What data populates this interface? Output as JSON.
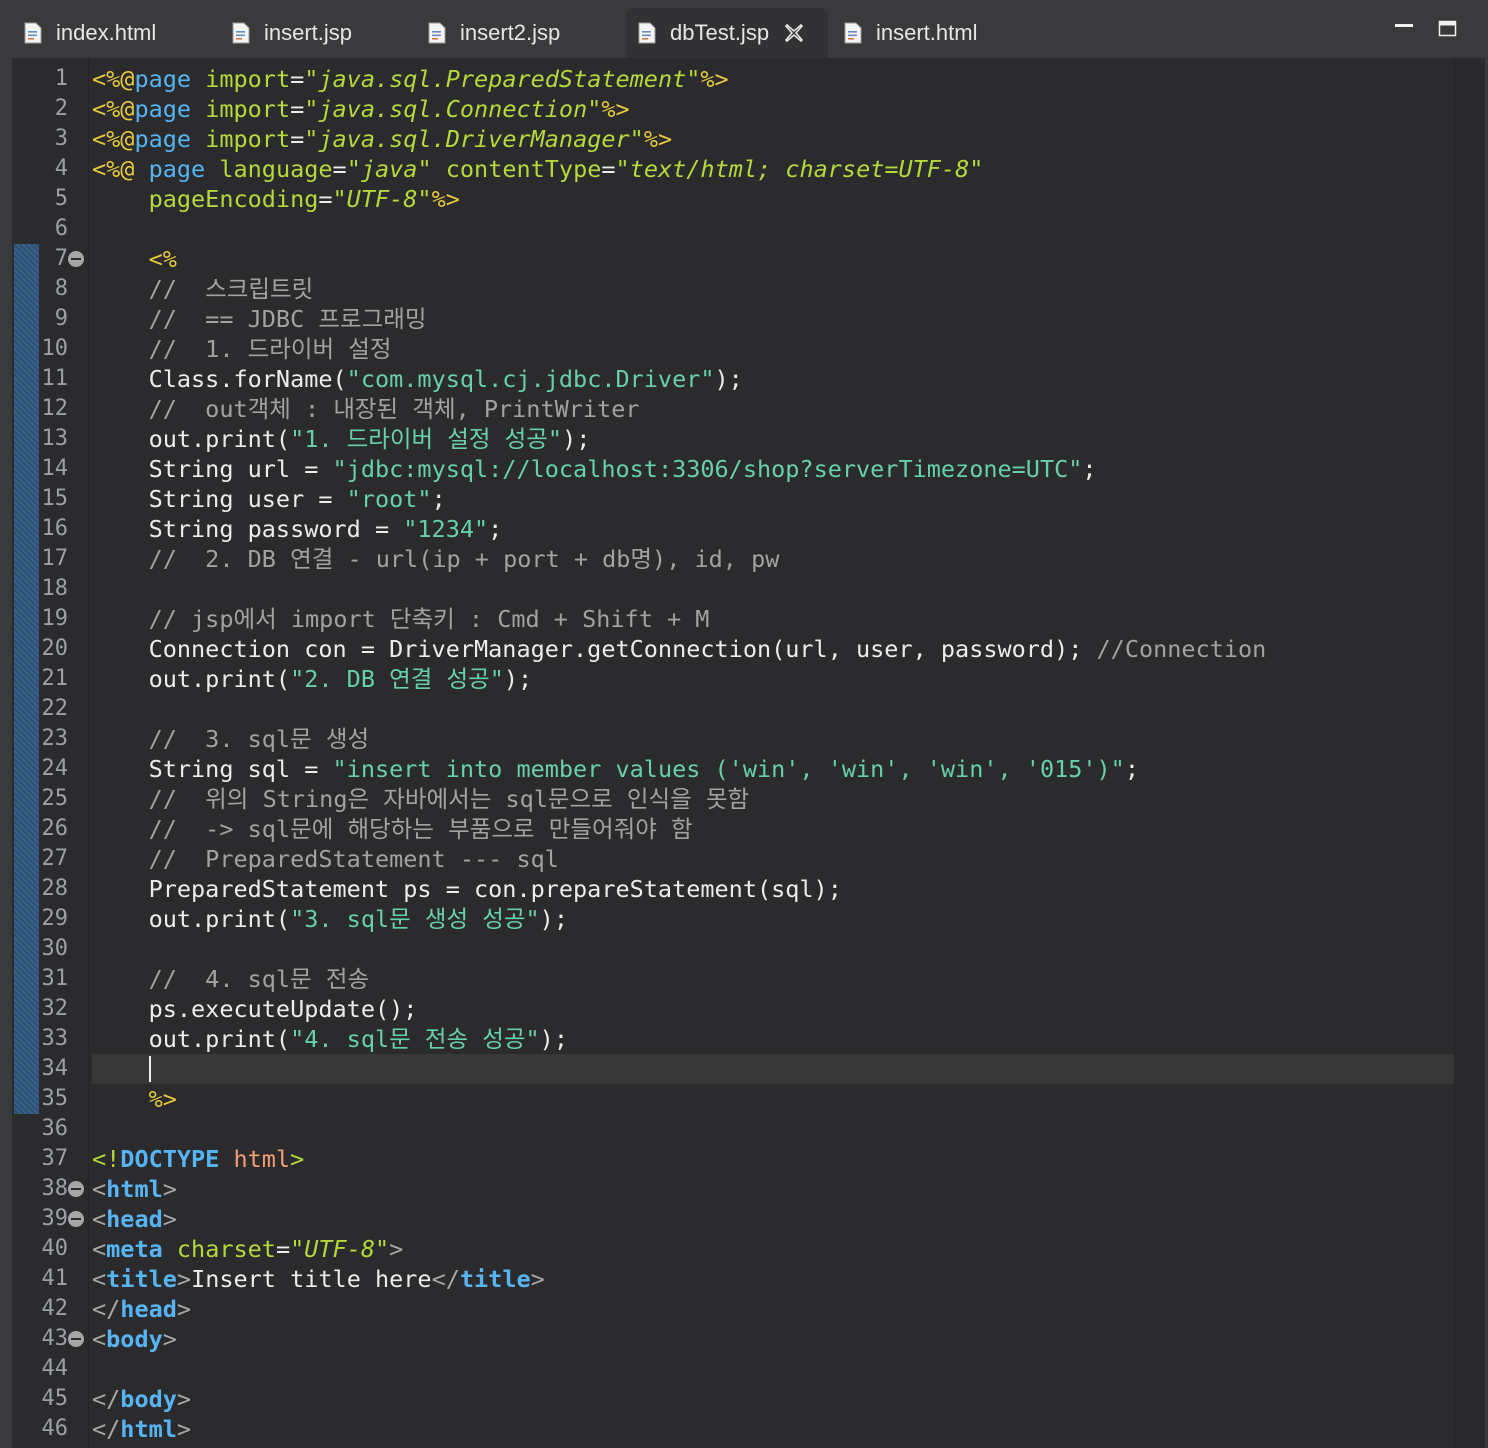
{
  "tabs": [
    {
      "label": "index.html",
      "active": false
    },
    {
      "label": "insert.jsp",
      "active": false
    },
    {
      "label": "insert2.jsp",
      "active": false
    },
    {
      "label": "dbTest.jsp",
      "active": true
    },
    {
      "label": "insert.html",
      "active": false
    }
  ],
  "editor": {
    "current_line": 34,
    "fold_lines": [
      7,
      38,
      39,
      43
    ],
    "lines": [
      [
        [
          "tag",
          "<%@"
        ],
        [
          "dir",
          "page"
        ],
        [
          "plain",
          " "
        ],
        [
          "attr",
          "import"
        ],
        [
          "plain",
          "="
        ],
        [
          "val",
          "\"java.sql.PreparedStatement\""
        ],
        [
          "tag",
          "%>"
        ]
      ],
      [
        [
          "tag",
          "<%@"
        ],
        [
          "dir",
          "page"
        ],
        [
          "plain",
          " "
        ],
        [
          "attr",
          "import"
        ],
        [
          "plain",
          "="
        ],
        [
          "val",
          "\"java.sql.Connection\""
        ],
        [
          "tag",
          "%>"
        ]
      ],
      [
        [
          "tag",
          "<%@"
        ],
        [
          "dir",
          "page"
        ],
        [
          "plain",
          " "
        ],
        [
          "attr",
          "import"
        ],
        [
          "plain",
          "="
        ],
        [
          "val",
          "\"java.sql.DriverManager\""
        ],
        [
          "tag",
          "%>"
        ]
      ],
      [
        [
          "tag",
          "<%@"
        ],
        [
          "plain",
          " "
        ],
        [
          "dir",
          "page"
        ],
        [
          "plain",
          " "
        ],
        [
          "attr",
          "language"
        ],
        [
          "plain",
          "="
        ],
        [
          "val",
          "\"java\""
        ],
        [
          "plain",
          " "
        ],
        [
          "attr",
          "contentType"
        ],
        [
          "plain",
          "="
        ],
        [
          "val",
          "\"text/html; charset=UTF-8\""
        ]
      ],
      [
        [
          "plain",
          "    "
        ],
        [
          "attr",
          "pageEncoding"
        ],
        [
          "plain",
          "="
        ],
        [
          "val",
          "\"UTF-8\""
        ],
        [
          "tag",
          "%>"
        ]
      ],
      [],
      [
        [
          "plain",
          "    "
        ],
        [
          "tag",
          "<%"
        ]
      ],
      [
        [
          "comment",
          "    //  스크립트릿"
        ]
      ],
      [
        [
          "comment",
          "    //  == JDBC 프로그래밍"
        ]
      ],
      [
        [
          "comment",
          "    //  1. 드라이버 설정"
        ]
      ],
      [
        [
          "plain",
          "    Class.forName("
        ],
        [
          "str",
          "\"com.mysql.cj.jdbc.Driver\""
        ],
        [
          "plain",
          ");"
        ]
      ],
      [
        [
          "comment",
          "    //  out객체 : 내장된 객체, PrintWriter"
        ]
      ],
      [
        [
          "plain",
          "    out.print("
        ],
        [
          "str",
          "\"1. 드라이버 설정 성공\""
        ],
        [
          "plain",
          ");"
        ]
      ],
      [
        [
          "plain",
          "    String url = "
        ],
        [
          "str",
          "\"jdbc:mysql://localhost:3306/shop?serverTimezone=UTC\""
        ],
        [
          "plain",
          ";"
        ]
      ],
      [
        [
          "plain",
          "    String user = "
        ],
        [
          "str",
          "\"root\""
        ],
        [
          "plain",
          ";"
        ]
      ],
      [
        [
          "plain",
          "    String password = "
        ],
        [
          "str",
          "\"1234\""
        ],
        [
          "plain",
          ";"
        ]
      ],
      [
        [
          "comment",
          "    //  2. DB 연결 - url(ip + port + db명), id, pw"
        ]
      ],
      [],
      [
        [
          "comment",
          "    // jsp에서 import 단축키 : Cmd + Shift + M"
        ]
      ],
      [
        [
          "plain",
          "    Connection con = DriverManager.getConnection(url, user, password); "
        ],
        [
          "comment",
          "//Connection"
        ]
      ],
      [
        [
          "plain",
          "    out.print("
        ],
        [
          "str",
          "\"2. DB 연결 성공\""
        ],
        [
          "plain",
          ");"
        ]
      ],
      [],
      [
        [
          "comment",
          "    //  3. sql문 생성"
        ]
      ],
      [
        [
          "plain",
          "    String sql = "
        ],
        [
          "str",
          "\"insert into member values ('win', 'win', 'win', '015')\""
        ],
        [
          "plain",
          ";"
        ]
      ],
      [
        [
          "comment",
          "    //  위의 String은 자바에서는 sql문으로 인식을 못함"
        ]
      ],
      [
        [
          "comment",
          "    //  -> sql문에 해당하는 부품으로 만들어줘야 함"
        ]
      ],
      [
        [
          "comment",
          "    //  PreparedStatement --- sql"
        ]
      ],
      [
        [
          "plain",
          "    PreparedStatement ps = con.prepareStatement(sql);"
        ]
      ],
      [
        [
          "plain",
          "    out.print("
        ],
        [
          "str",
          "\"3. sql문 생성 성공\""
        ],
        [
          "plain",
          ");"
        ]
      ],
      [],
      [
        [
          "comment",
          "    //  4. sql문 전송"
        ]
      ],
      [
        [
          "plain",
          "    ps.executeUpdate();"
        ]
      ],
      [
        [
          "plain",
          "    out.print("
        ],
        [
          "str",
          "\"4. sql문 전송 성공\""
        ],
        [
          "plain",
          ");"
        ]
      ],
      [
        [
          "plain",
          "    "
        ]
      ],
      [
        [
          "plain",
          "    "
        ],
        [
          "tag",
          "%>"
        ]
      ],
      [],
      [
        [
          "dtpunc",
          "<!"
        ],
        [
          "dt",
          "DOCTYPE"
        ],
        [
          "plain",
          " "
        ],
        [
          "dtname",
          "html"
        ],
        [
          "dtpunc",
          ">"
        ]
      ],
      [
        [
          "br",
          "<"
        ],
        [
          "el",
          "html"
        ],
        [
          "br",
          ">"
        ]
      ],
      [
        [
          "br",
          "<"
        ],
        [
          "el",
          "head"
        ],
        [
          "br",
          ">"
        ]
      ],
      [
        [
          "br",
          "<"
        ],
        [
          "el",
          "meta"
        ],
        [
          "plain",
          " "
        ],
        [
          "attr",
          "charset"
        ],
        [
          "plain",
          "="
        ],
        [
          "val",
          "\"UTF-8\""
        ],
        [
          "br",
          ">"
        ]
      ],
      [
        [
          "br",
          "<"
        ],
        [
          "el",
          "title"
        ],
        [
          "br",
          ">"
        ],
        [
          "plain",
          "Insert title here"
        ],
        [
          "br",
          "</"
        ],
        [
          "el",
          "title"
        ],
        [
          "br",
          ">"
        ]
      ],
      [
        [
          "br",
          "</"
        ],
        [
          "el",
          "head"
        ],
        [
          "br",
          ">"
        ]
      ],
      [
        [
          "br",
          "<"
        ],
        [
          "el",
          "body"
        ],
        [
          "br",
          ">"
        ]
      ],
      [],
      [
        [
          "br",
          "</"
        ],
        [
          "el",
          "body"
        ],
        [
          "br",
          ">"
        ]
      ],
      [
        [
          "br",
          "</"
        ],
        [
          "el",
          "html"
        ],
        [
          "br",
          ">"
        ]
      ]
    ]
  }
}
